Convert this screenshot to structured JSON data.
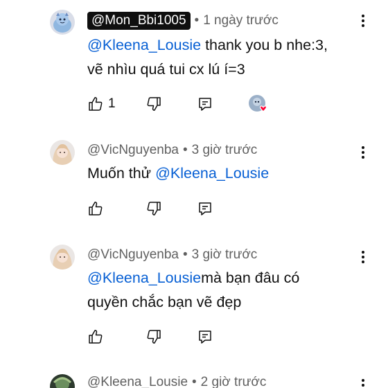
{
  "comments": [
    {
      "author": "@Mon_Bbi1005",
      "time": "1 ngày trước",
      "mention": "@Kleena_Lousie",
      "text_line1": " thank you b nhe:3,",
      "text_line2": "vẽ nhìu quá tui cx lú í=3",
      "likes": "1",
      "creator_heart": true
    },
    {
      "author": "@VicNguyenba",
      "time": "3 giờ trước",
      "text_prefix": "Muốn thử ",
      "mention": "@Kleena_Lousie"
    },
    {
      "author": "@VicNguyenba",
      "time": "3 giờ trước",
      "mention": "@Kleena_Lousie",
      "text_line1": "mà bạn đâu có",
      "text_line2": "quyền chắc bạn vẽ đẹp"
    },
    {
      "author": "@Kleena_Lousie",
      "time": "2 giờ trước"
    }
  ],
  "separator": "•",
  "icons": {
    "like": "thumb-up-icon",
    "dislike": "thumb-down-icon",
    "reply": "reply-icon",
    "more": "more-vertical-icon",
    "heart": "creator-heart-icon"
  },
  "colors": {
    "mention": "#065fd4",
    "meta": "#606060",
    "text": "#0f0f0f",
    "heart": "#ff0033"
  }
}
